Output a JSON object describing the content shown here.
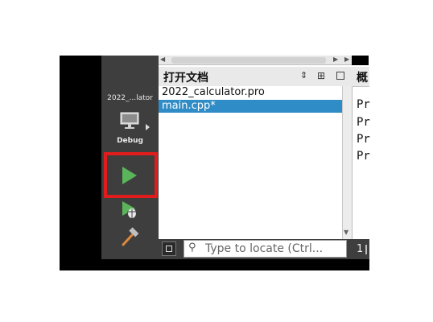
{
  "mode_bar": {
    "kit_name": "2022_...lator",
    "build_config": "Debug",
    "icons": [
      "monitor-icon",
      "run-icon",
      "debug-run-icon",
      "build-hammer-icon"
    ],
    "highlight_color": "#e11c1c",
    "run_color": "#5ab55a"
  },
  "open_documents": {
    "title": "打开文档",
    "files": [
      "2022_calculator.pro",
      "main.cpp*"
    ],
    "selected_index": 1,
    "selection_color": "#308cc6"
  },
  "editor": {
    "tab_title": "概",
    "lines": [
      "Pr",
      "Pr",
      "Pr",
      "Pr"
    ]
  },
  "locator": {
    "placeholder": "Type to locate (Ctrl..."
  },
  "status": {
    "issues_count": "1"
  }
}
